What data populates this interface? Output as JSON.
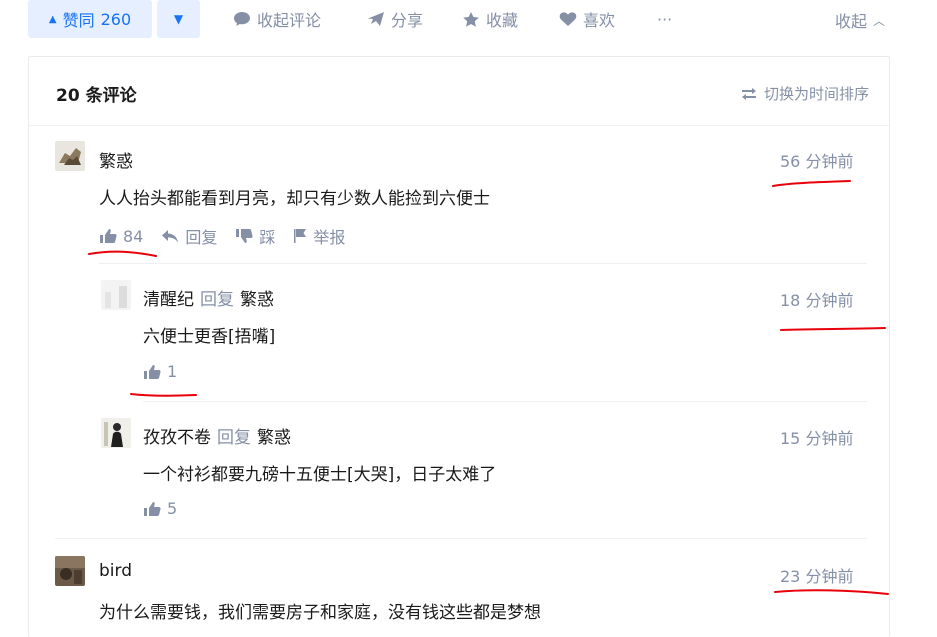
{
  "action_bar": {
    "vote_up_label": "赞同",
    "vote_up_count": "260",
    "collapse_comments": "收起评论",
    "share": "分享",
    "favorite": "收藏",
    "like": "喜欢",
    "more": "···",
    "collapse": "收起"
  },
  "comments": {
    "count_label": "20 条评论",
    "sort_toggle": "切换为时间排序",
    "items": [
      {
        "author": "繁惑",
        "time": "56 分钟前",
        "content": "人人抬头都能看到月亮，却只有少数人能捡到六便士",
        "likes": "84",
        "reply": "回复",
        "dislike": "踩",
        "report": "举报"
      },
      {
        "author": "清醒纪",
        "reply_word": "回复",
        "reply_to": "繁惑",
        "time": "18 分钟前",
        "content": "六便士更香[捂嘴]",
        "likes": "1"
      },
      {
        "author": "孜孜不卷",
        "reply_word": "回复",
        "reply_to": "繁惑",
        "time": "15 分钟前",
        "content": "一个衬衫都要九磅十五便士[大哭]，日子太难了",
        "likes": "5"
      },
      {
        "author": "bird",
        "time": "23 分钟前",
        "content": "为什么需要钱，我们需要房子和家庭，没有钱这些都是梦想"
      }
    ]
  },
  "colors": {
    "accent": "#1772f6",
    "accent_bg": "#e5efff",
    "muted": "#8590a6",
    "annotation_red": "#e8000b"
  },
  "icons": [
    "triangle-up-icon",
    "triangle-down-icon",
    "comment-bubble-icon",
    "share-plane-icon",
    "star-icon",
    "heart-icon",
    "more-dots-icon",
    "chevron-up-icon",
    "swap-arrows-icon",
    "thumbs-up-icon",
    "reply-arrow-icon",
    "thumbs-down-icon",
    "flag-icon"
  ]
}
